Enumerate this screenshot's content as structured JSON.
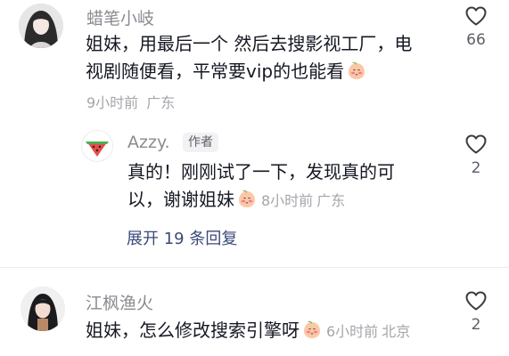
{
  "comments": [
    {
      "username": "蜡笔小岐",
      "text_line1": "姐妹，用最后一个 然后去搜影视工厂，电",
      "text_line2": "视剧随便看，平常要vip的也能看",
      "time": "9小时前",
      "location": "广东",
      "likes": "66"
    },
    {
      "username": "江枫渔火",
      "text": "姐妹，怎么修改搜索引擎呀",
      "time": "6小时前",
      "location": "北京",
      "likes": "2"
    }
  ],
  "reply": {
    "username": "Azzy.",
    "author_badge": "作者",
    "text_line1": "真的！刚刚试了一下，发现真的可",
    "text_line2": "以，谢谢姐妹",
    "time": "8小时前",
    "location": "广东",
    "likes": "2",
    "expand_label": "展开 19 条回复"
  },
  "icons": {
    "like": "heart-outline-icon",
    "emoji": "peach-blush-emoji",
    "reply_avatar": "watermelon-icon"
  },
  "colors": {
    "username": "#8a8b91",
    "expand_link": "#3b4a78",
    "meta": "#a5a6ab"
  }
}
